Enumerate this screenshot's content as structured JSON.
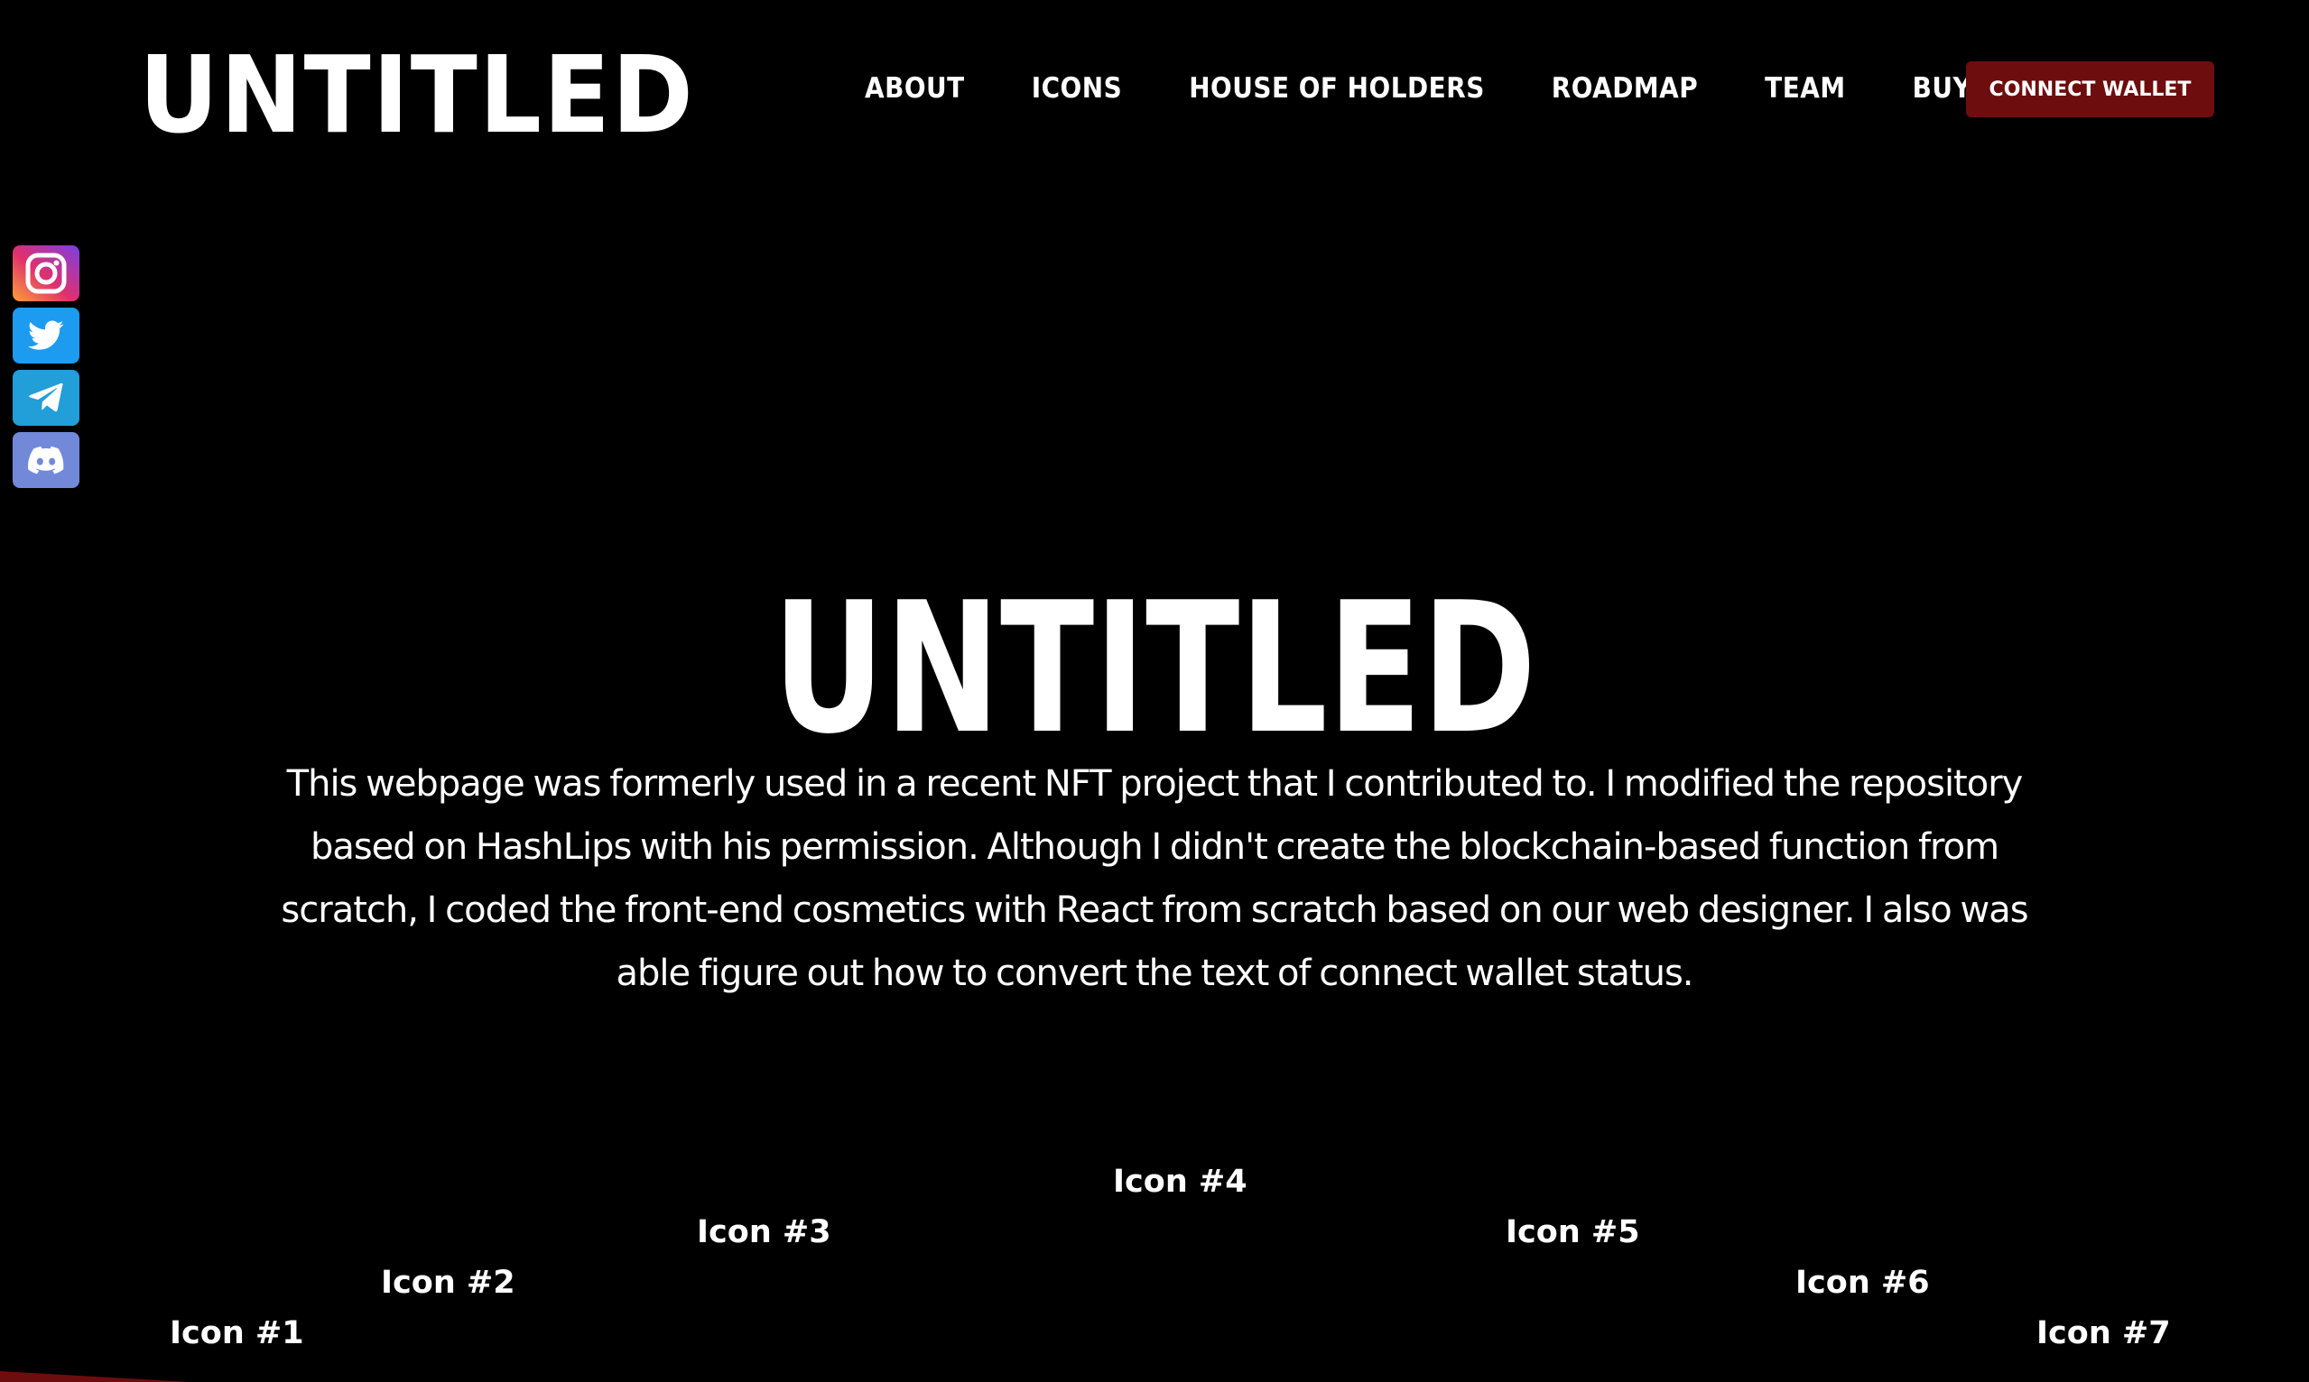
{
  "header": {
    "logo": "UNTITLED",
    "nav": [
      {
        "label": "ABOUT"
      },
      {
        "label": "ICONS"
      },
      {
        "label": "HOUSE OF HOLDERS"
      },
      {
        "label": "ROADMAP"
      },
      {
        "label": "TEAM"
      },
      {
        "label": "BUY NOW"
      }
    ],
    "connect_button": "CONNECT WALLET"
  },
  "social": [
    {
      "name": "instagram",
      "icon": "instagram-icon"
    },
    {
      "name": "twitter",
      "icon": "twitter-icon"
    },
    {
      "name": "telegram",
      "icon": "telegram-icon"
    },
    {
      "name": "discord",
      "icon": "discord-icon"
    }
  ],
  "hero": {
    "title": "UNTITLED",
    "description": "This webpage was formerly used in a recent NFT project that I contributed to. I modified the repository based on HashLips with his permission. Although I didn't create the blockchain-based function from scratch, I coded the front-end cosmetics with React from scratch based on our web designer. I also was able figure out how to convert the text of connect wallet status."
  },
  "icons": [
    {
      "label": "Icon #1"
    },
    {
      "label": "Icon #2"
    },
    {
      "label": "Icon #3"
    },
    {
      "label": "Icon #4"
    },
    {
      "label": "Icon #5"
    },
    {
      "label": "Icon #6"
    },
    {
      "label": "Icon #7"
    }
  ],
  "colors": {
    "background": "#000000",
    "text": "#ffffff",
    "accent": "#6e0d0d",
    "instagram": "#c13584",
    "twitter": "#1d9bf0",
    "telegram": "#229ed9",
    "discord": "#7289da"
  }
}
